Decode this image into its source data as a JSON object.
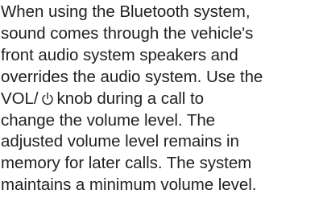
{
  "document": {
    "lines": [
      "When using the Bluetooth system,",
      "sound comes through the vehicle's",
      "front audio system speakers and",
      "overrides the audio system. Use the",
      {
        "before": "VOL/",
        "icon": "power-icon",
        "after": "knob during a call to"
      },
      "change the volume level. The",
      "adjusted volume level remains in",
      "memory for later calls. The system",
      "maintains a minimum volume level."
    ]
  },
  "colors": {
    "text": "#231f20",
    "background": "#ffffff"
  }
}
